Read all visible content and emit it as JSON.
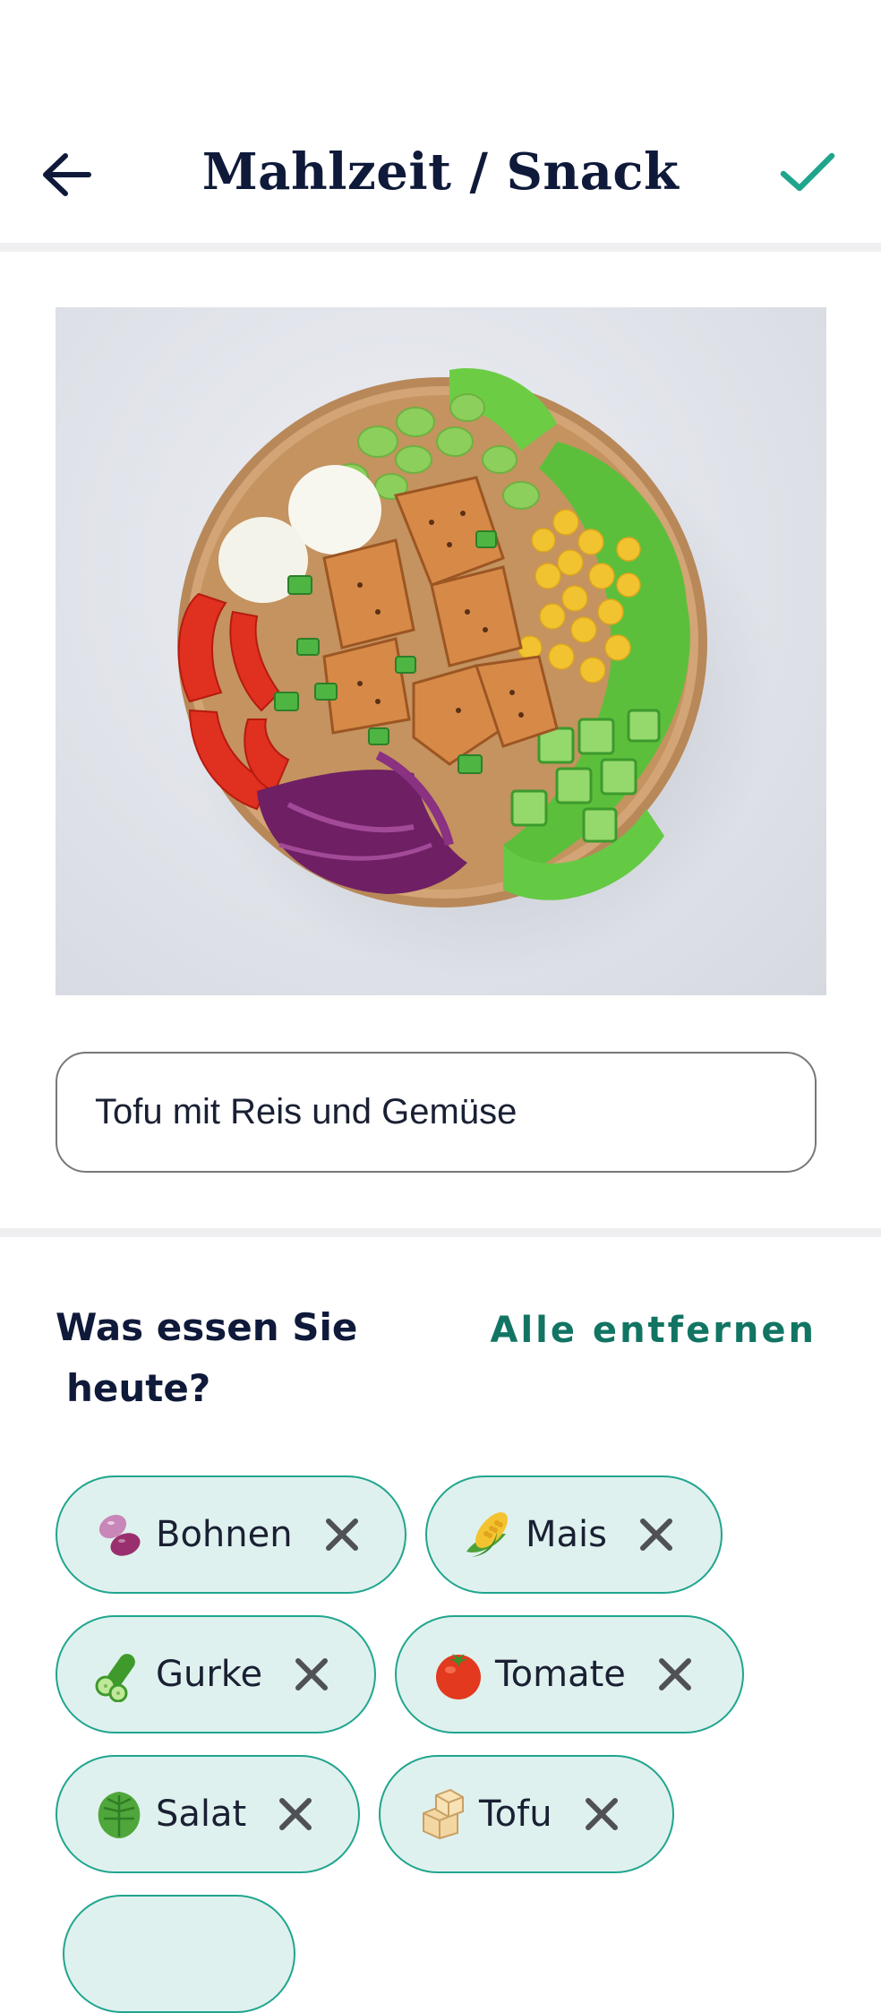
{
  "header": {
    "title": "Mahlzeit / Snack",
    "back_icon": "arrow-left-icon",
    "confirm_icon": "checkmark-icon"
  },
  "photo": {
    "alt": "Tofu-Bowl mit Gemüse"
  },
  "meal_name": {
    "value": "Tofu mit Reis und Gemüse"
  },
  "ingredients_section": {
    "title_line1": "Was essen Sie",
    "title_line2": "heute?",
    "remove_all_label": "Alle entfernen"
  },
  "ingredients": [
    {
      "label": "Bohnen",
      "icon": "beans-icon"
    },
    {
      "label": "Mais",
      "icon": "corn-icon"
    },
    {
      "label": "Gurke",
      "icon": "cucumber-icon"
    },
    {
      "label": "Tomate",
      "icon": "tomato-icon"
    },
    {
      "label": "Salat",
      "icon": "lettuce-icon"
    },
    {
      "label": "Tofu",
      "icon": "tofu-icon"
    }
  ],
  "colors": {
    "accent": "#127563",
    "chip_border": "#21a58e",
    "chip_bg": "#dff1ee",
    "title": "#0f1a3a"
  }
}
